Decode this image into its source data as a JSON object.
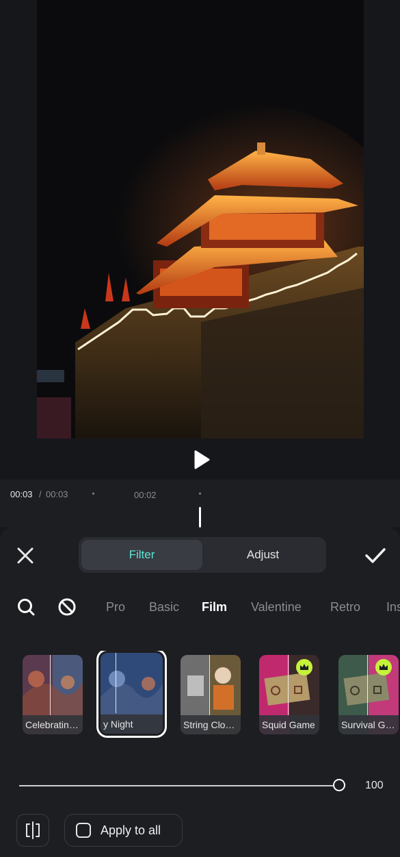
{
  "player": {
    "current_time": "00:03",
    "separator": "/",
    "total_time": "00:03",
    "tick_label": "00:02"
  },
  "panel": {
    "tabs": [
      {
        "label": "Filter",
        "active": true
      },
      {
        "label": "Adjust",
        "active": false
      }
    ],
    "categories": [
      {
        "label": "Pro",
        "active": false
      },
      {
        "label": "Basic",
        "active": false
      },
      {
        "label": "Film",
        "active": true
      },
      {
        "label": "Valentine",
        "active": false
      },
      {
        "label": "Retro",
        "active": false
      },
      {
        "label": "Ins",
        "active": false
      }
    ],
    "filters": [
      {
        "label": "Celebratin…",
        "selected": false,
        "premium": false
      },
      {
        "label": "y Night",
        "selected": true,
        "premium": false
      },
      {
        "label": "String Clo…",
        "selected": false,
        "premium": false
      },
      {
        "label": "Squid Game",
        "selected": false,
        "premium": true
      },
      {
        "label": "Survival G…",
        "selected": false,
        "premium": true
      }
    ],
    "intensity": 100,
    "intensity_label": "100",
    "apply_all_label": "Apply to all",
    "apply_all_checked": false
  },
  "colors": {
    "accent": "#5ee6d6",
    "premium_badge": "#c5f23a",
    "background": "#16171b",
    "panel": "#1d1e22"
  },
  "icons": {
    "close": "close-icon",
    "confirm": "checkmark-icon",
    "search": "search-icon",
    "no_filter": "no-filter-icon",
    "play": "play-icon",
    "compare": "compare-split-icon",
    "crown": "crown-icon"
  }
}
